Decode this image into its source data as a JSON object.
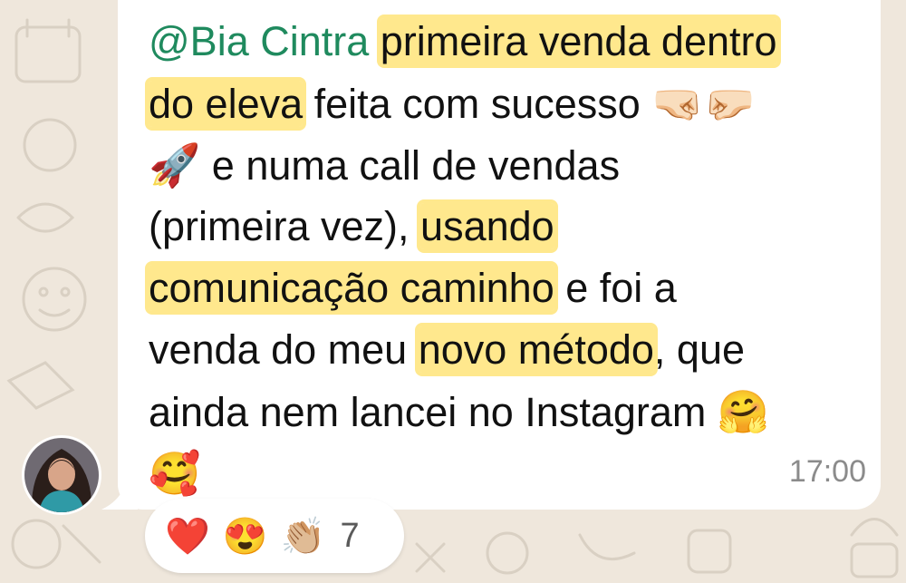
{
  "message": {
    "mention": "@Bia Cintra",
    "line1_text": "primeira venda dentro",
    "line2_hl": "do eleva",
    "line2_text": " feita com sucesso ",
    "line2_emoji": "🤜🏻🤛🏻",
    "line3_emoji": "🚀",
    "line3_text": " e numa call de vendas",
    "line4_text_a": "(primeira vez), ",
    "line4_hl": "usando",
    "line5_hl": "comunicação caminho",
    "line5_text": " e foi a",
    "line6_text_a": "venda do meu ",
    "line6_hl": "novo método",
    "line6_text_b": ", que",
    "line7_text": "ainda nem lancei no Instagram ",
    "line7_emoji": "🤗",
    "line8_emoji": "🥰",
    "time": "17:00"
  },
  "reactions": {
    "items": [
      {
        "emoji": "❤️",
        "icon": "heart-icon"
      },
      {
        "emoji": "😍",
        "icon": "heart-eyes-icon"
      },
      {
        "emoji": "👏🏼",
        "icon": "clapping-hands-icon"
      }
    ],
    "count": "7"
  },
  "colors": {
    "wallpaper": "#efe7dc",
    "bubble": "#ffffff",
    "mention": "#1f8a5e",
    "highlight": "#ffd630",
    "time": "#8b8b8b"
  }
}
